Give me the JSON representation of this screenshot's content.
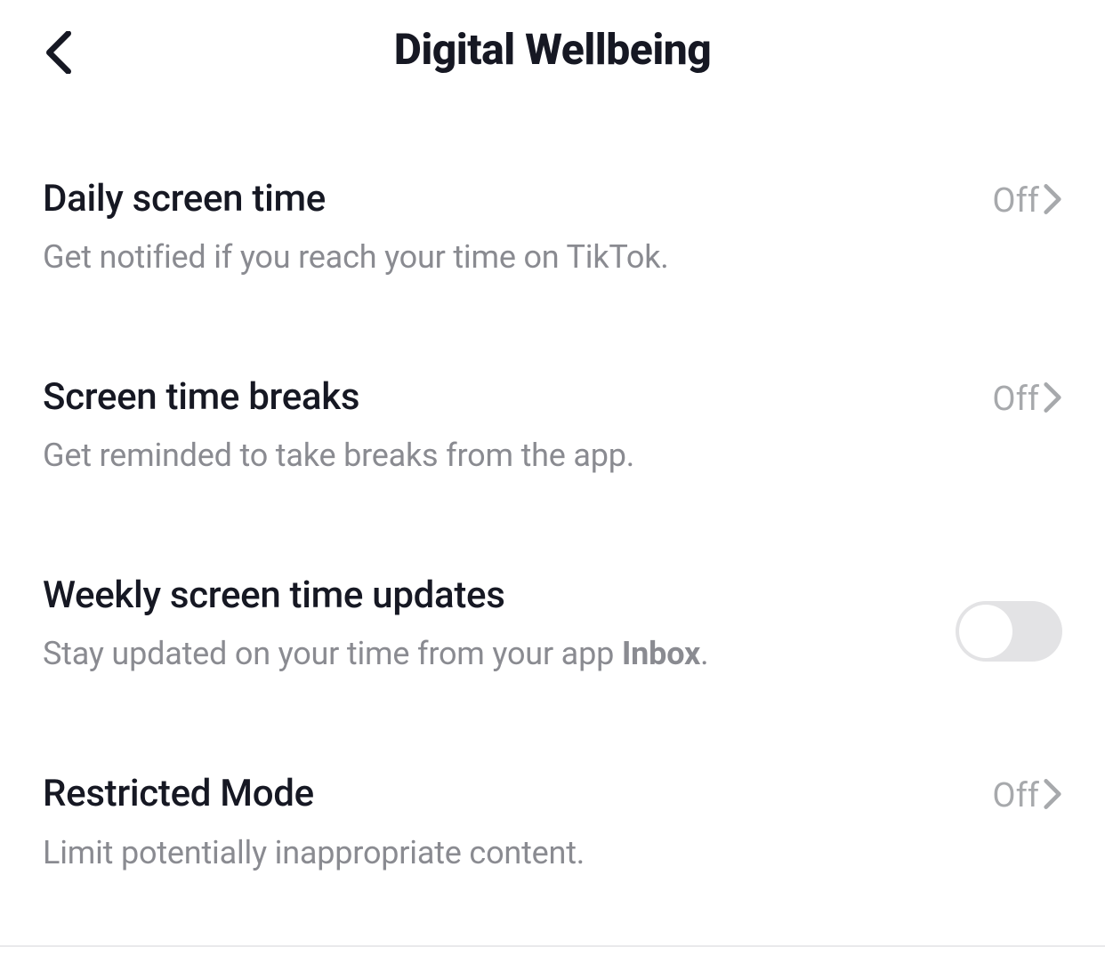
{
  "header": {
    "title": "Digital Wellbeing"
  },
  "settings": {
    "daily_screen_time": {
      "title": "Daily screen time",
      "description": "Get notified if you reach your time on TikTok.",
      "value": "Off"
    },
    "screen_time_breaks": {
      "title": "Screen time breaks",
      "description": "Get reminded to take breaks from the app.",
      "value": "Off"
    },
    "weekly_updates": {
      "title": "Weekly screen time updates",
      "description_prefix": "Stay updated on your time from your app ",
      "description_bold": "Inbox",
      "description_suffix": ".",
      "toggle_on": false
    },
    "restricted_mode": {
      "title": "Restricted Mode",
      "description": "Limit potentially inappropriate content.",
      "value": "Off"
    }
  }
}
